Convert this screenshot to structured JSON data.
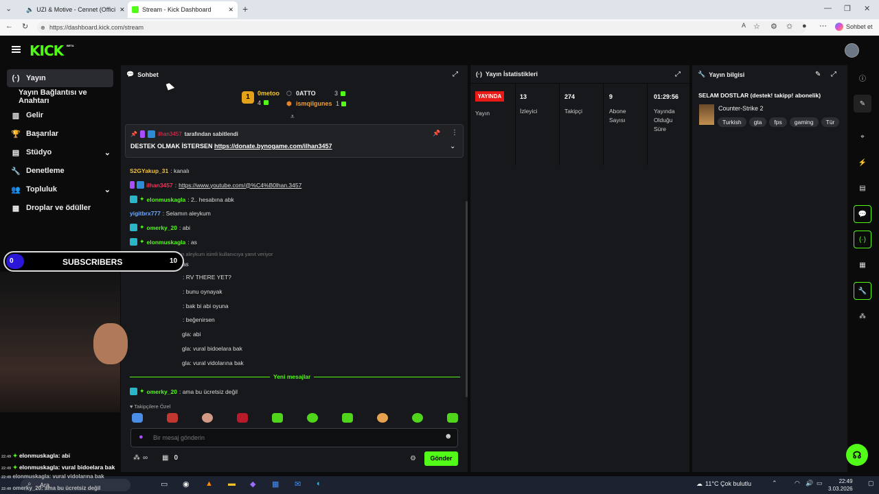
{
  "browser": {
    "tabs": [
      "UZI & Motive - Cennet (Offici",
      "Stream - Kick Dashboard"
    ],
    "url": "https://dashboard.kick.com/stream",
    "copilot_label": "Sohbet et"
  },
  "app": {
    "logo": "KICK",
    "logo_beta": "BETA"
  },
  "sidebar": {
    "items": [
      {
        "label": "Yayın",
        "icon": "broadcast-icon"
      },
      {
        "label": "Yayın Bağlantısı ve Anahtarı",
        "icon": ""
      },
      {
        "label": "Gelir",
        "icon": "chart-icon"
      },
      {
        "label": "Başarılar",
        "icon": "trophy-icon"
      },
      {
        "label": "Stüdyo",
        "icon": "studio-icon"
      },
      {
        "label": "Denetleme",
        "icon": "wrench-icon"
      },
      {
        "label": "Topluluk",
        "icon": "people-icon"
      },
      {
        "label": "Droplar ve ödüller",
        "icon": "gift-icon"
      }
    ]
  },
  "chat": {
    "title": "Sohbet",
    "leaderboard": {
      "first_name": "0metoo",
      "first_rank": "1",
      "first_count": "4",
      "second_name": "0ATTO",
      "second_count": "3",
      "third_name": "ismqilgunes",
      "third_count": "1"
    },
    "pinned": {
      "pinned_by_user": "ilhan3457",
      "pinned_by_text": "tarafından sabitlendi",
      "message_prefix": "DESTEK OLMAK İSTERSEN ",
      "message_link": "https://donate.bynogame.com/ilhan3457"
    },
    "messages": [
      {
        "user": "S2GYakup_31",
        "text": ": kanalı",
        "color": "#f0c040"
      },
      {
        "user": "ilhan3457",
        "text": ": ",
        "link": "https://www.youtube.com/@%C4%B0lhan.3457",
        "color": "#e8365a"
      },
      {
        "user": "elonmuskagla",
        "text": ": 2.. hesabına abk",
        "color": "#53fc18"
      },
      {
        "user": "yigitbrx777",
        "text": ": Selamın aleykum",
        "color": "#6fa8ff"
      },
      {
        "user": "omerky_20",
        "text": ": abi",
        "color": "#53fc18"
      },
      {
        "user": "elonmuskagla",
        "text": ": as",
        "color": "#53fc18"
      }
    ],
    "reply_note": "yigitbrx777: Selamın aleykum isimli kullanıcıya yanıt veriyor",
    "reply_message": {
      "user": "omerky_20",
      "text": ": as"
    },
    "partial_messages": [
      ": RV THERE YET?",
      ": bunu oynayak",
      ": bak bi abi oyuna",
      ": beğenirsen",
      "gla: abi",
      "gla: vural bidoelara bak",
      "gla: vural vidolarına bak"
    ],
    "new_messages_label": "Yeni mesajlar",
    "last_message": {
      "user": "omerky_20",
      "text": ": ama bu ücretsiz değil"
    },
    "followers_only": "Takipçilere Özel",
    "input_placeholder": "Bir mesaj gönderin",
    "viewers_infinite": "∞",
    "gift_count": "0",
    "send_label": "Gönder"
  },
  "stats": {
    "title": "Yayın İstatistikleri",
    "live_badge": "YAYINDA",
    "live_label": "Yayın",
    "items": [
      {
        "value": "13",
        "label": "İzleyici"
      },
      {
        "value": "274",
        "label": "Takipçi"
      },
      {
        "value": "9",
        "label": "Abone Sayısı"
      },
      {
        "value": "01:29:56",
        "label": "Yayında Olduğu Süre"
      }
    ]
  },
  "info": {
    "title": "Yayın bilgisi",
    "stream_title": "SELAM DOSTLAR (destek! takipp! abonelik)",
    "category": "Counter-Strike 2",
    "tags": [
      "Turkish",
      "gta",
      "fps",
      "gaming",
      "Tür"
    ]
  },
  "overlay": {
    "sub_count": "0",
    "sub_label": "SUBSCRIBERS",
    "sub_goal": "10",
    "lines": [
      {
        "time": "22:49",
        "user": "elonmuskagla",
        "text": ": abi"
      },
      {
        "time": "22:49",
        "user": "elonmuskagla",
        "text": ": vural bidoelara bak"
      },
      {
        "time": "22:49",
        "user": "elonmuskagla",
        "text": ": vural vidolarına bak"
      },
      {
        "time": "22:49",
        "user": "omerky_20",
        "text": ": ama bu ücretsiz değil"
      }
    ]
  },
  "taskbar": {
    "search": "Ara",
    "weather": "11°C  Çok bulutlu",
    "time": "22:49",
    "date": "3.03.2026"
  },
  "colors": {
    "kick_green": "#53fc18",
    "live_red": "#e91916",
    "panel": "#17181c"
  }
}
